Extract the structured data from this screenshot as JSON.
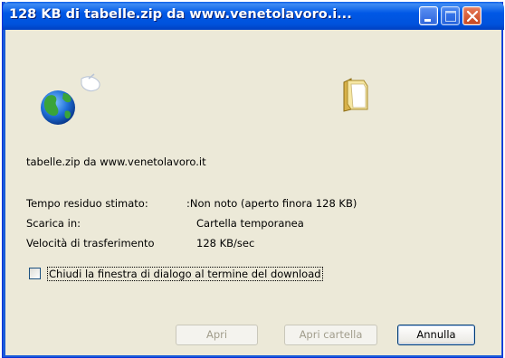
{
  "window": {
    "title": "128 KB di tabelle.zip da www.venetolavoro.i..."
  },
  "icons": {
    "globe": "globe-icon",
    "folder": "folder-icon",
    "minimize": "minimize-icon",
    "maximize": "maximize-icon",
    "close": "close-icon"
  },
  "download": {
    "file_source": "tabelle.zip da www.venetolavoro.it",
    "rows": [
      {
        "label": "Tempo residuo stimato:",
        "value": ":Non noto (aperto finora 128 KB)"
      },
      {
        "label": "Scarica in:",
        "value": "Cartella temporanea"
      },
      {
        "label": "Velocità di trasferimento",
        "value": "128 KB/sec"
      }
    ],
    "close_checkbox_label": "Chiudi la finestra di dialogo al termine del download",
    "close_checkbox_checked": false
  },
  "buttons": {
    "open": "Apri",
    "open_folder": "Apri cartella",
    "cancel": "Annulla"
  },
  "colors": {
    "titlebar": "#0058e6",
    "dialog_bg": "#ece9d8"
  }
}
